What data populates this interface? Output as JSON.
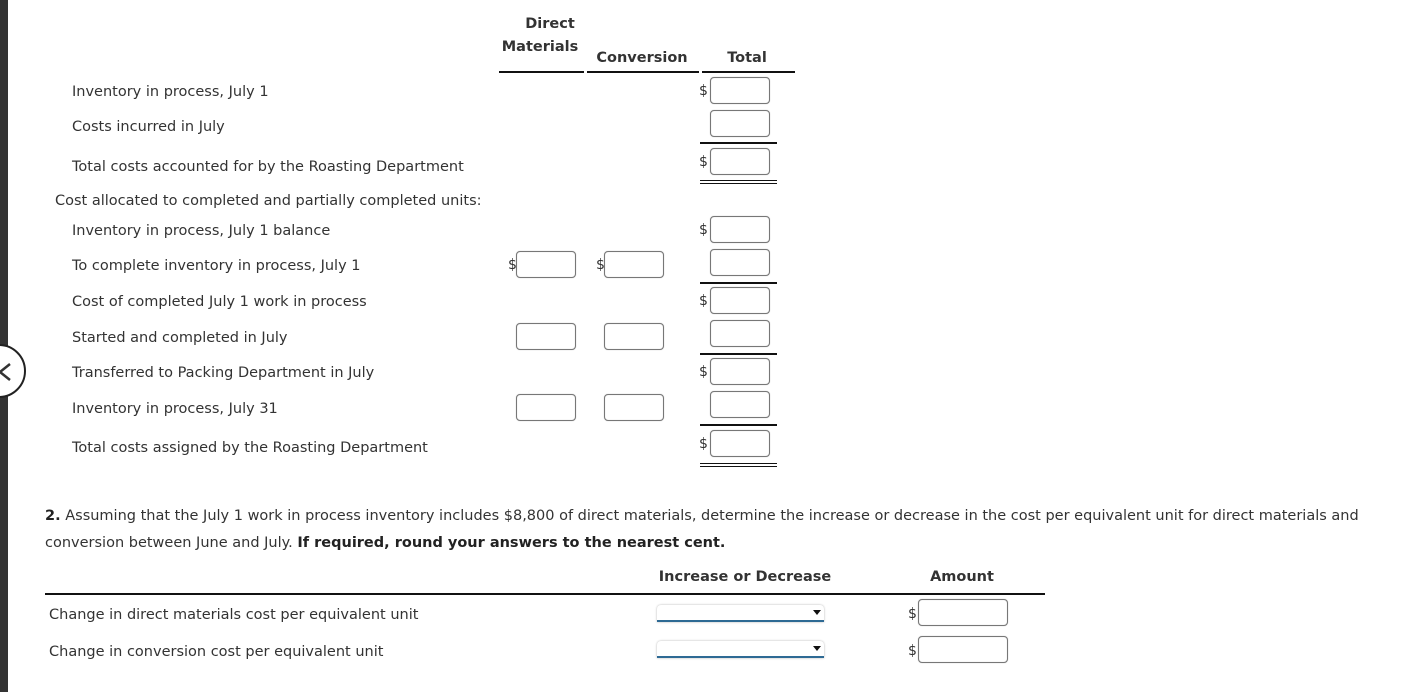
{
  "nav": {
    "back_icon": "chevron-left-icon"
  },
  "part1": {
    "columns": {
      "direct_materials_line1": "Direct",
      "direct_materials_line2": "Materials",
      "conversion": "Conversion",
      "total": "Total"
    },
    "currency_symbol": "$",
    "rows": [
      {
        "label": "Inventory in process, July 1",
        "total": ""
      },
      {
        "label": "Costs incurred in July",
        "total": ""
      },
      {
        "label": "Total costs accounted for by the Roasting Department",
        "total": ""
      },
      {
        "label": "Cost allocated to completed and partially completed units:"
      },
      {
        "label": "Inventory in process, July 1 balance",
        "total": ""
      },
      {
        "label": "To complete inventory in process, July 1",
        "direct_materials": "",
        "conversion": "",
        "total": ""
      },
      {
        "label": "Cost of completed July 1 work in process",
        "total": ""
      },
      {
        "label": "Started and completed in July",
        "direct_materials": "",
        "conversion": "",
        "total": ""
      },
      {
        "label": "Transferred to Packing Department in July",
        "total": ""
      },
      {
        "label": "Inventory in process, July 31",
        "direct_materials": "",
        "conversion": "",
        "total": ""
      },
      {
        "label": "Total costs assigned by the Roasting Department",
        "total": ""
      }
    ]
  },
  "part2": {
    "number": "2.",
    "text": " Assuming that the July 1 work in process inventory includes $8,800 of direct materials, determine the increase or decrease in the cost per equivalent unit for direct materials and conversion between June and July. ",
    "instruction": "If required, round your answers to the nearest cent.",
    "columns": {
      "change": "Increase or Decrease",
      "amount": "Amount"
    },
    "currency_symbol": "$",
    "rows": [
      {
        "label": "Change in direct materials cost per equivalent unit",
        "selected": "",
        "amount": ""
      },
      {
        "label": "Change in conversion cost per equivalent unit",
        "selected": "",
        "amount": ""
      }
    ]
  }
}
